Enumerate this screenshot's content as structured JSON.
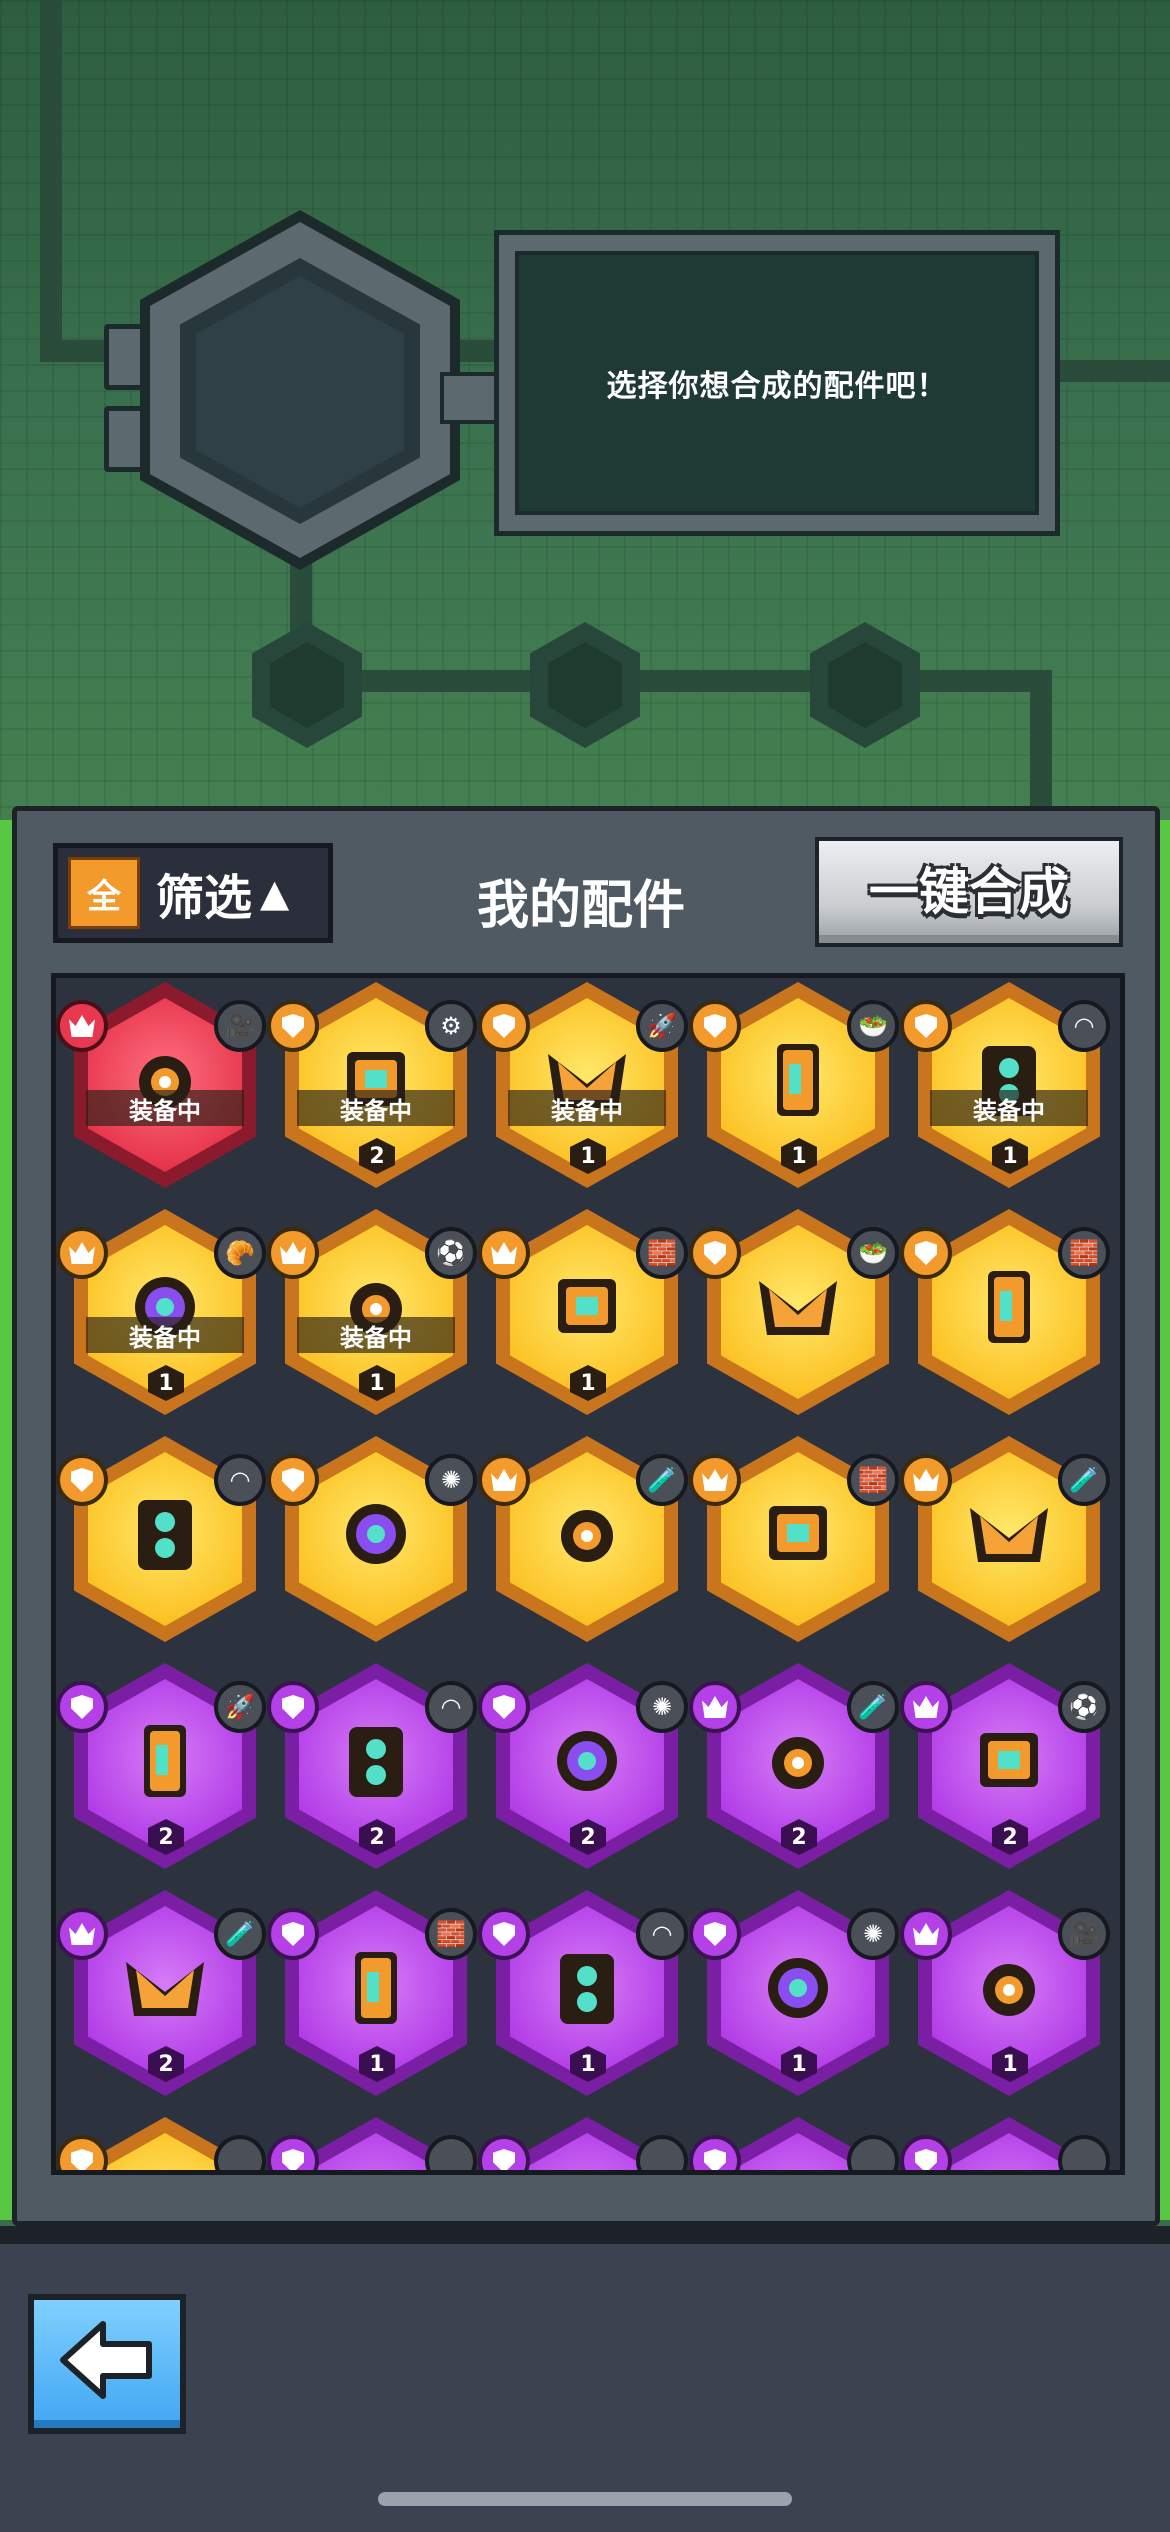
{
  "dialog": {
    "message": "选择你想合成的配件吧！"
  },
  "panel": {
    "title": "我的配件",
    "filter": {
      "all_badge": "全",
      "label": "筛选",
      "arrow": "▲"
    },
    "combine_button": "一键合成"
  },
  "equipped_label": "装备中",
  "items": [
    {
      "rarity": "red",
      "rank": "crown",
      "slot": "🎥",
      "equipped": true,
      "level": ""
    },
    {
      "rarity": "gold",
      "rank": "shield",
      "slot": "⚙",
      "equipped": true,
      "level": "2"
    },
    {
      "rarity": "gold",
      "rank": "shield",
      "slot": "🚀",
      "equipped": true,
      "level": "1"
    },
    {
      "rarity": "gold",
      "rank": "shield",
      "slot": "🥗",
      "equipped": false,
      "level": "1"
    },
    {
      "rarity": "gold",
      "rank": "shield",
      "slot": "◠",
      "equipped": true,
      "level": "1"
    },
    {
      "rarity": "gold",
      "rank": "crown",
      "slot": "🥐",
      "equipped": true,
      "level": "1"
    },
    {
      "rarity": "gold",
      "rank": "crown",
      "slot": "⚽",
      "equipped": true,
      "level": "1"
    },
    {
      "rarity": "gold",
      "rank": "crown",
      "slot": "🧱",
      "equipped": false,
      "level": "1"
    },
    {
      "rarity": "gold",
      "rank": "shield",
      "slot": "🥗",
      "equipped": false,
      "level": ""
    },
    {
      "rarity": "gold",
      "rank": "shield",
      "slot": "🧱",
      "equipped": false,
      "level": ""
    },
    {
      "rarity": "gold",
      "rank": "shield",
      "slot": "◠",
      "equipped": false,
      "level": ""
    },
    {
      "rarity": "gold",
      "rank": "shield",
      "slot": "✺",
      "equipped": false,
      "level": ""
    },
    {
      "rarity": "gold",
      "rank": "crown",
      "slot": "🧪",
      "equipped": false,
      "level": ""
    },
    {
      "rarity": "gold",
      "rank": "crown",
      "slot": "🧱",
      "equipped": false,
      "level": ""
    },
    {
      "rarity": "gold",
      "rank": "crown",
      "slot": "🧪",
      "equipped": false,
      "level": ""
    },
    {
      "rarity": "purple",
      "rank": "shield",
      "slot": "🚀",
      "equipped": false,
      "level": "2"
    },
    {
      "rarity": "purple",
      "rank": "shield",
      "slot": "◠",
      "equipped": false,
      "level": "2"
    },
    {
      "rarity": "purple",
      "rank": "shield",
      "slot": "✺",
      "equipped": false,
      "level": "2"
    },
    {
      "rarity": "purple",
      "rank": "crown",
      "slot": "🧪",
      "equipped": false,
      "level": "2"
    },
    {
      "rarity": "purple",
      "rank": "crown",
      "slot": "⚽",
      "equipped": false,
      "level": "2"
    },
    {
      "rarity": "purple",
      "rank": "crown",
      "slot": "🧪",
      "equipped": false,
      "level": "2"
    },
    {
      "rarity": "purple",
      "rank": "shield",
      "slot": "🧱",
      "equipped": false,
      "level": "1"
    },
    {
      "rarity": "purple",
      "rank": "shield",
      "slot": "◠",
      "equipped": false,
      "level": "1"
    },
    {
      "rarity": "purple",
      "rank": "shield",
      "slot": "✺",
      "equipped": false,
      "level": "1"
    },
    {
      "rarity": "purple",
      "rank": "crown",
      "slot": "🎥",
      "equipped": false,
      "level": "1"
    }
  ],
  "colors": {
    "gold": "#fcc428",
    "purple": "#b440e8",
    "red": "#e8384f",
    "accent": "#f39a2d"
  }
}
